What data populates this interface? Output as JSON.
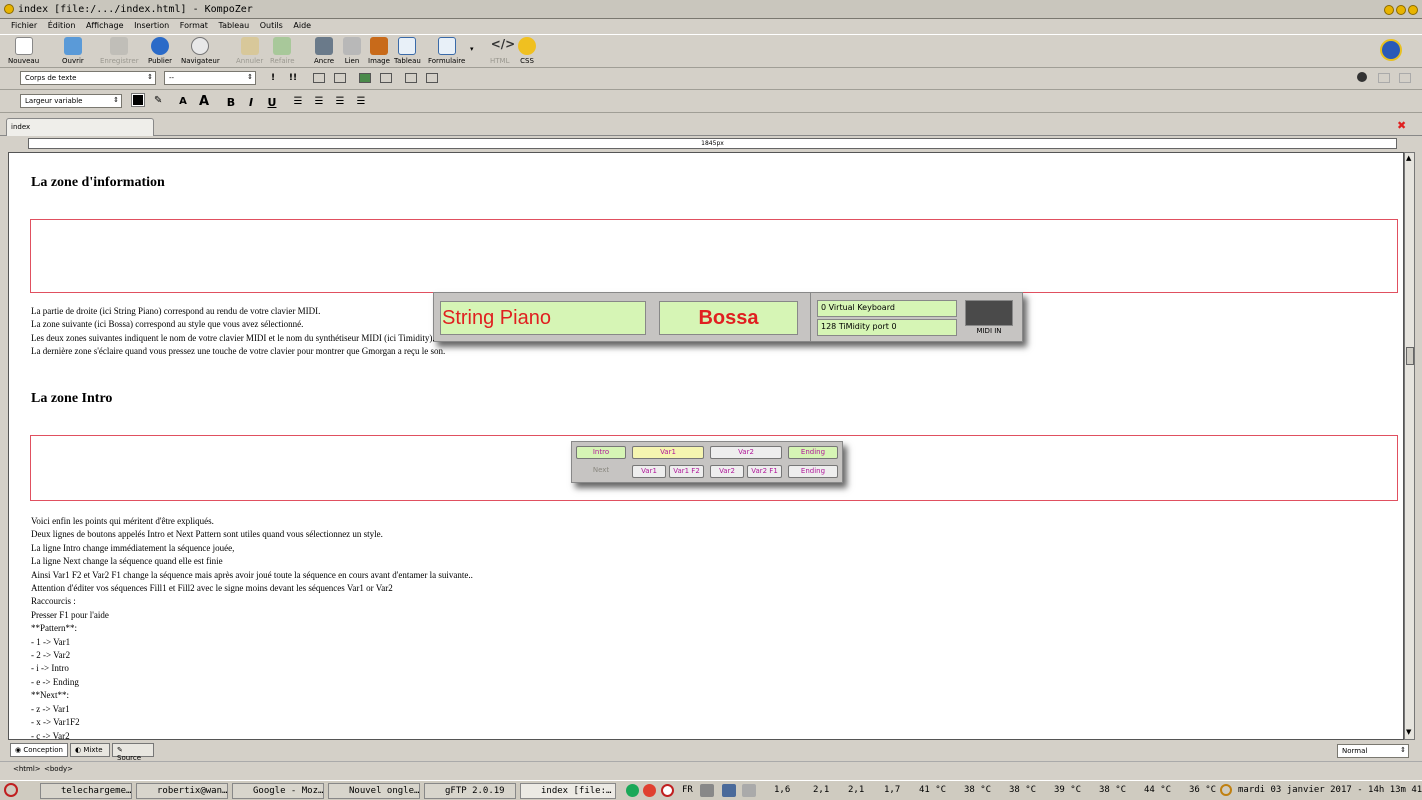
{
  "window": {
    "title": "index [file:/.../index.html] - KompoZer"
  },
  "menu": [
    "Fichier",
    "Édition",
    "Affichage",
    "Insertion",
    "Format",
    "Tableau",
    "Outils",
    "Aide"
  ],
  "toolbar": {
    "nouveau": "Nouveau",
    "ouvrir": "Ouvrir",
    "enregistrer": "Enregistrer",
    "publier": "Publier",
    "navigateur": "Navigateur",
    "annuler": "Annuler",
    "refaire": "Refaire",
    "ancre": "Ancre",
    "lien": "Lien",
    "image": "Image",
    "tableau": "Tableau",
    "formulaire": "Formulaire",
    "html": "HTML",
    "css": "CSS"
  },
  "format": {
    "paragraph_style": "Corps de texte",
    "class_style": "--",
    "font": "Largeur variable"
  },
  "tab": {
    "label": "index"
  },
  "ruler": {
    "width_label": "1845px"
  },
  "content": {
    "heading1": "La zone d'information",
    "info_panel": {
      "instrument": "String Piano",
      "style": "Bossa",
      "midi_in_port": "0 Virtual Keyboard",
      "midi_out_port": "128 TiMidity port 0",
      "midi_in_label": "MIDI IN"
    },
    "para1": [
      "La partie de droite (ici String Piano) correspond au rendu de votre clavier MIDI.",
      "La zone suivante (ici Bossa) correspond au style que vous avez sélectionné.",
      "Les deux zones suivantes indiquent le nom de votre clavier MIDI et le nom du synthétiseur MIDI (ici Timidity).",
      "La dernière zone s'éclaire quand vous pressez une touche de votre clavier pour montrer que Gmorgan a reçu le son."
    ],
    "heading2": "La zone Intro",
    "intro_panel": {
      "row1": [
        "Intro",
        "Var1",
        "Var2",
        "Ending"
      ],
      "next_label": "Next",
      "row2": [
        "Var1",
        "Var1 F2",
        "Var2",
        "Var2 F1",
        "Ending"
      ]
    },
    "para2": [
      "Voici enfin les points qui méritent d'être expliqués.",
      "Deux lignes de boutons appelés Intro et Next Pattern sont utiles quand vous sélectionnez un style.",
      "La ligne Intro change immédiatement la séquence jouée,",
      "La ligne Next change la séquence quand elle est finie",
      "Ainsi Var1 F2 et Var2 F1 change la séquence mais après avoir joué toute la séquence en cours avant d'entamer la suivante..",
      "Attention d'éditer vos séquences Fill1 et Fill2 avec le signe moins devant les séquences Var1 or Var2",
      "Raccourcis :",
      "Presser F1 pour l'aide",
      "**Pattern**:",
      "- 1 -> Var1",
      "- 2 -> Var2",
      "- i -> Intro",
      "- e -> Ending",
      "**Next**:",
      "- z -> Var1",
      "- x -> Var1F2",
      "- c -> Var2"
    ]
  },
  "bottom_tabs": {
    "conception": "Conception",
    "mixte": "Mixte",
    "source": "Source",
    "view_mode": "Normal"
  },
  "status": {
    "html_tag": "<html>",
    "body_tag": "<body>"
  },
  "taskbar": {
    "tasks": [
      "telechargeme…",
      "robertix@wan…",
      "Google - Moz…",
      "Nouvel ongle…",
      "gFTP 2.0.19",
      "index [file:…"
    ],
    "lang": "FR",
    "cpu": [
      "1,6",
      "2,1",
      "2,1",
      "1,7"
    ],
    "temps": [
      "41 °C",
      "38 °C",
      "38 °C",
      "39 °C",
      "38 °C",
      "44 °C",
      "36 °C"
    ],
    "clock": "mardi 03 janvier 2017 - 14h 13m 41s"
  },
  "colors": {
    "accent_red": "#e02020",
    "lcd_green": "#d6f5b5",
    "button_magenta": "#b0189a",
    "frame_red": "#e05060"
  }
}
